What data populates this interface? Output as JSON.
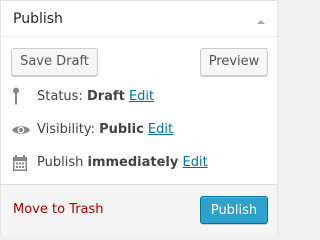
{
  "panel": {
    "title": "Publish"
  },
  "actions": {
    "save_draft_label": "Save Draft",
    "preview_label": "Preview"
  },
  "misc": {
    "status": {
      "label": "Status:",
      "value": "Draft",
      "edit": "Edit",
      "icon": "pin-icon"
    },
    "visibility": {
      "label": "Visibility:",
      "value": "Public",
      "edit": "Edit",
      "icon": "eye-icon"
    },
    "schedule": {
      "label": "Publish",
      "value": "immediately",
      "edit": "Edit",
      "icon": "calendar-icon"
    }
  },
  "major": {
    "trash_label": "Move to Trash",
    "publish_label": "Publish"
  },
  "colors": {
    "link": "#0073aa",
    "trash": "#aa0000",
    "primary": "#2ea2cc"
  }
}
